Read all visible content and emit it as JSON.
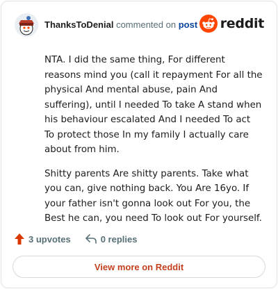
{
  "header": {
    "username": "ThanksToDenial",
    "action_text": "commented on",
    "post_link": "post",
    "brand": "reddit"
  },
  "comment": {
    "paragraphs": [
      "NTA. I did the same thing, For different reasons mind you (call it repayment For all the physical And mental abuse, pain And suffering), until I needed To take A stand when his behaviour escalated And I needed To act To protect those In my family I actually care about from him.",
      "Shitty parents Are shitty parents. Take what you can, give nothing back. You Are 16yo. If your father isn't gonna look out For you, the Best he can, you need To look out For yourself."
    ]
  },
  "actions": {
    "upvotes": "3 upvotes",
    "replies": "0 replies"
  },
  "footer": {
    "view_more": "View more on Reddit"
  },
  "colors": {
    "brand_orange": "#ff4500",
    "upvote_orange": "#d93900",
    "link_blue": "#0a449b",
    "view_more_text": "#c4401f"
  },
  "icons": {
    "avatar": "snoo-avatar-icon",
    "brand": "reddit-logo-icon",
    "upvote": "upvote-arrow-icon",
    "reply": "reply-arrow-icon"
  }
}
